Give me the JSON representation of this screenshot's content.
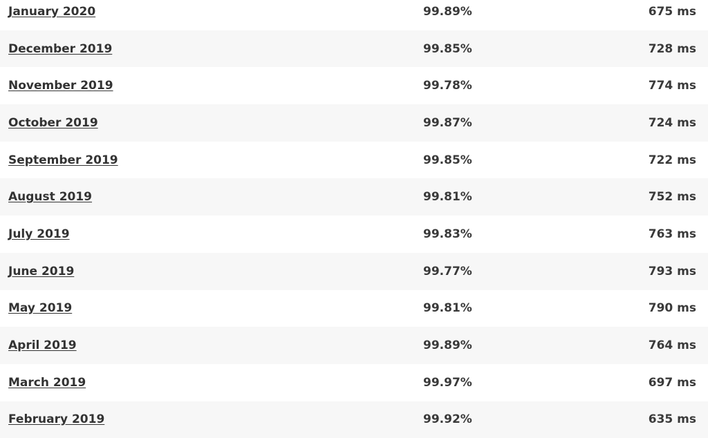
{
  "rows": [
    {
      "month": "January 2020",
      "uptime": "99.89%",
      "response_time": "675 ms"
    },
    {
      "month": "December 2019",
      "uptime": "99.85%",
      "response_time": "728 ms"
    },
    {
      "month": "November 2019",
      "uptime": "99.78%",
      "response_time": "774 ms"
    },
    {
      "month": "October 2019",
      "uptime": "99.87%",
      "response_time": "724 ms"
    },
    {
      "month": "September 2019",
      "uptime": "99.85%",
      "response_time": "722 ms"
    },
    {
      "month": "August 2019",
      "uptime": "99.81%",
      "response_time": "752 ms"
    },
    {
      "month": "July 2019",
      "uptime": "99.83%",
      "response_time": "763 ms"
    },
    {
      "month": "June 2019",
      "uptime": "99.77%",
      "response_time": "793 ms"
    },
    {
      "month": "May 2019",
      "uptime": "99.81%",
      "response_time": "790 ms"
    },
    {
      "month": "April 2019",
      "uptime": "99.89%",
      "response_time": "764 ms"
    },
    {
      "month": "March 2019",
      "uptime": "99.97%",
      "response_time": "697 ms"
    },
    {
      "month": "February 2019",
      "uptime": "99.92%",
      "response_time": "635 ms"
    }
  ]
}
